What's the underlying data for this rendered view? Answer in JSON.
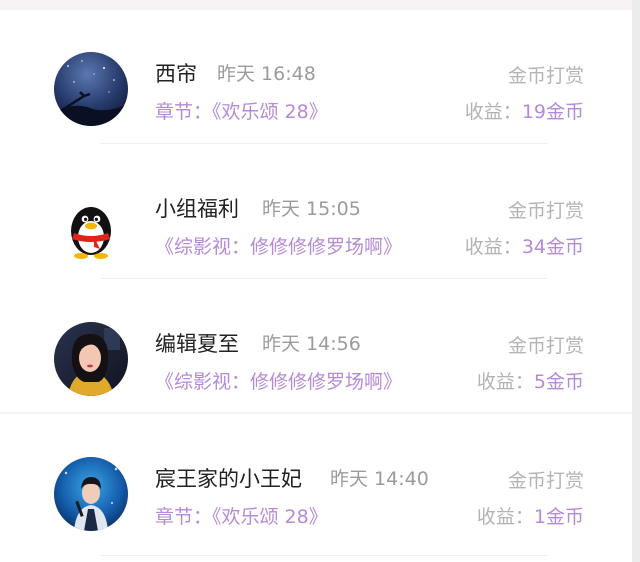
{
  "entries": [
    {
      "name": "西帘",
      "time": "昨天 16:48",
      "action": "金币打赏",
      "work": "章节：《欢乐颂 28》",
      "earnings_label": "收益：",
      "earnings_value": "19金币",
      "avatar_icon": "starry-night-avatar"
    },
    {
      "name": "小组福利",
      "time": "昨天 15:05",
      "action": "金币打赏",
      "work": "《综影视：修修修修罗场啊》",
      "earnings_label": "收益：",
      "earnings_value": "34金币",
      "avatar_icon": "qq-penguin-avatar"
    },
    {
      "name": "编辑夏至",
      "time": "昨天 14:56",
      "action": "金币打赏",
      "work": "《综影视：修修修修罗场啊》",
      "earnings_label": "收益：",
      "earnings_value": "5金币",
      "avatar_icon": "portrait-woman-avatar"
    },
    {
      "name": "宸王家的小王妃",
      "time": "昨天 14:40",
      "action": "金币打赏",
      "work": "章节：《欢乐颂 28》",
      "earnings_label": "收益：",
      "earnings_value": "1金币",
      "avatar_icon": "stage-performer-avatar"
    }
  ],
  "colors": {
    "accent": "#b58ad6",
    "muted": "#b4b4b4",
    "name": "#222222"
  }
}
